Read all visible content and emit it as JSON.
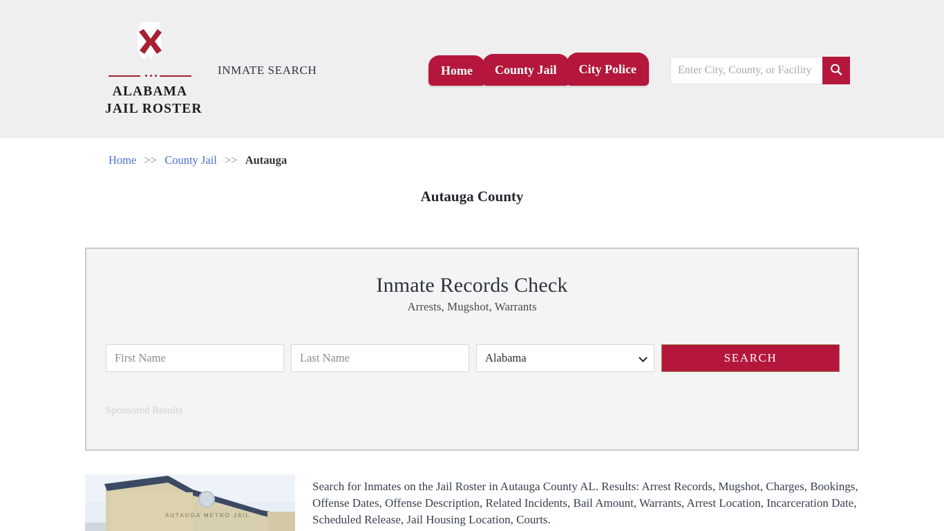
{
  "header": {
    "logo": {
      "line1": "ALABAMA",
      "line2": "JAIL ROSTER",
      "icon": "alabama-state-flag-mark"
    },
    "tagline": "INMATE SEARCH",
    "nav": [
      {
        "label": "Home"
      },
      {
        "label": "County Jail"
      },
      {
        "label": "City Police"
      }
    ],
    "search": {
      "placeholder": "Enter City, County, or Facility",
      "value": "",
      "button_icon": "search-icon"
    }
  },
  "breadcrumb": {
    "items": [
      {
        "label": "Home",
        "link": true
      },
      {
        "label": "County Jail",
        "link": true
      },
      {
        "label": "Autauga",
        "link": false
      }
    ],
    "separator": ">>"
  },
  "page": {
    "title": "Autauga County"
  },
  "panel": {
    "title": "Inmate Records Check",
    "subtitle": "Arrests, Mugshot, Warrants",
    "form": {
      "first_name_placeholder": "First Name",
      "first_name_value": "",
      "last_name_placeholder": "Last Name",
      "last_name_value": "",
      "state_selected": "Alabama",
      "state_options": [
        "Alabama"
      ],
      "submit_label": "SEARCH"
    },
    "sponsored_note": "Sponsored Results"
  },
  "content": {
    "image_caption": "AUTAUGA METRO JAIL",
    "description": "Search for Inmates on the Jail Roster in Autauga County AL. Results: Arrest Records, Mugshot, Charges, Bookings, Offense Dates, Offense Description, Related Incidents, Bail Amount, Warrants, Arrest Location, Incarceration Date, Scheduled Release, Jail Housing Location, Courts."
  },
  "colors": {
    "brand_crimson": "#b5173c",
    "header_bg": "#efefef",
    "panel_bg": "#f4f4f4",
    "link_blue": "#4a6fd4"
  }
}
